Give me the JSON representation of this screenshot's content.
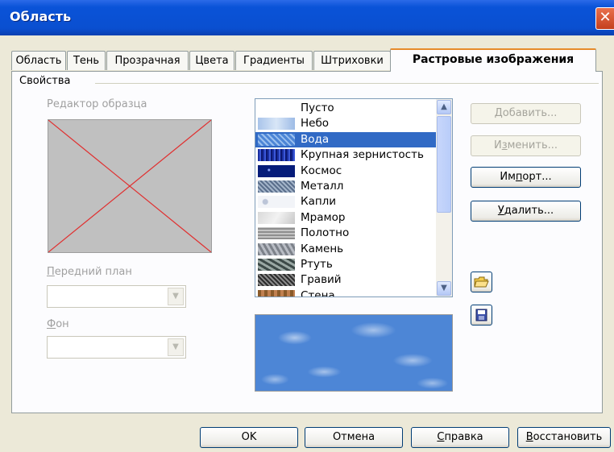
{
  "window": {
    "title": "Область",
    "close_glyph": "✕"
  },
  "tabs": [
    {
      "label": "Область"
    },
    {
      "label": "Тень"
    },
    {
      "label": "Прозрачная"
    },
    {
      "label": "Цвета"
    },
    {
      "label": "Градиенты"
    },
    {
      "label": "Штриховки"
    },
    {
      "label": "Растровые изображения",
      "active": true
    }
  ],
  "properties": {
    "group_label": "Свойства",
    "editor_label": "Редактор образца",
    "foreground_label": "Передний план",
    "background_label": "Фон",
    "foreground_value": "",
    "background_value": ""
  },
  "bitmap_list": {
    "items": [
      {
        "name": "Пусто",
        "pattern": "empty"
      },
      {
        "name": "Небо",
        "pattern": "sky"
      },
      {
        "name": "Вода",
        "pattern": "water",
        "selected": true
      },
      {
        "name": "Крупная зернистость",
        "pattern": "coarse"
      },
      {
        "name": "Космос",
        "pattern": "space"
      },
      {
        "name": "Металл",
        "pattern": "metal"
      },
      {
        "name": "Капли",
        "pattern": "drops"
      },
      {
        "name": "Мрамор",
        "pattern": "marble"
      },
      {
        "name": "Полотно",
        "pattern": "canvas"
      },
      {
        "name": "Камень",
        "pattern": "stone"
      },
      {
        "name": "Ртуть",
        "pattern": "mercury"
      },
      {
        "name": "Гравий",
        "pattern": "gravel"
      },
      {
        "name": "Стена",
        "pattern": "wall"
      }
    ]
  },
  "buttons": {
    "add_pre": "",
    "add_u": "Д",
    "add_post": "обавить...",
    "modify_pre": "И",
    "modify_u": "з",
    "modify_post": "менить...",
    "import_pre": "Им",
    "import_u": "п",
    "import_post": "орт...",
    "delete_pre": "",
    "delete_u": "У",
    "delete_post": "далить..."
  },
  "footer": {
    "ok": "OK",
    "cancel": "Отмена",
    "help_pre": "",
    "help_u": "С",
    "help_post": "правка",
    "reset_pre": "",
    "reset_u": "В",
    "reset_post": "осстановить"
  },
  "colors": {
    "accent": "#316ac5",
    "title_bar": "#0a53d8",
    "tab_highlight": "#e68b2c"
  }
}
